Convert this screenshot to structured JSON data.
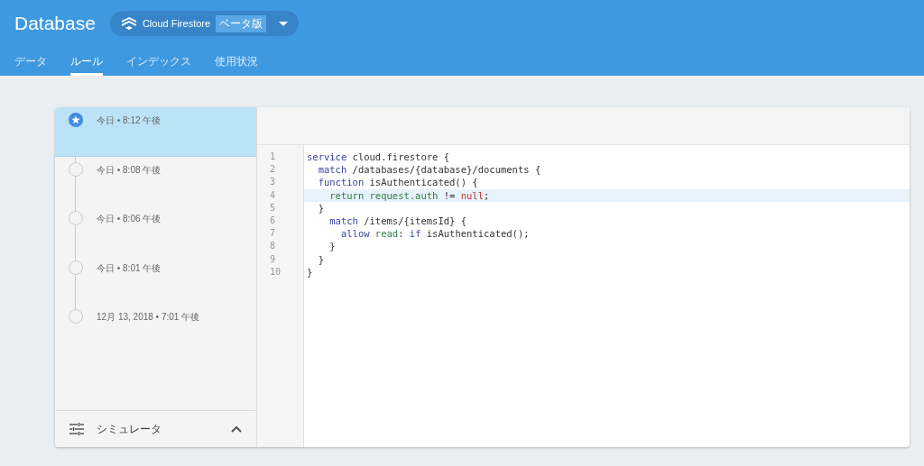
{
  "header": {
    "title": "Database",
    "product": {
      "name": "Cloud Firestore",
      "badge": "ベータ版"
    }
  },
  "tabs": [
    {
      "label": "データ",
      "selected": false
    },
    {
      "label": "ルール",
      "selected": true
    },
    {
      "label": "インデックス",
      "selected": false
    },
    {
      "label": "使用状況",
      "selected": false
    }
  ],
  "history": [
    {
      "label": "今日 • 8:12 午後",
      "selected": true
    },
    {
      "label": "今日 • 8:08 午後",
      "selected": false
    },
    {
      "label": "今日 • 8:06 午後",
      "selected": false
    },
    {
      "label": "今日 • 8:01 午後",
      "selected": false
    },
    {
      "label": "12月 13, 2018 • 7:01 午後",
      "selected": false
    }
  ],
  "simulator": {
    "label": "シミュレータ",
    "expanded": false
  },
  "code": [
    {
      "number": "1",
      "highlighted": false,
      "tokens": [
        {
          "kind": "keyword",
          "text": "service"
        },
        {
          "kind": "plain",
          "text": " cloud.firestore {"
        }
      ]
    },
    {
      "number": "2",
      "highlighted": false,
      "tokens": [
        {
          "kind": "keyword",
          "text": "  match"
        },
        {
          "kind": "plain",
          "text": " /databases/{database}/documents {"
        }
      ]
    },
    {
      "number": "3",
      "highlighted": false,
      "tokens": [
        {
          "kind": "keyword",
          "text": "  function"
        },
        {
          "kind": "plain",
          "text": " isAuthenticated() {"
        }
      ]
    },
    {
      "number": "4",
      "highlighted": true,
      "tokens": [
        {
          "kind": "name",
          "text": "    return request.auth"
        },
        {
          "kind": "plain",
          "text": " != "
        },
        {
          "kind": "literal",
          "text": "null"
        },
        {
          "kind": "plain",
          "text": ";"
        }
      ]
    },
    {
      "number": "5",
      "highlighted": false,
      "tokens": [
        {
          "kind": "plain",
          "text": "  }"
        }
      ]
    },
    {
      "number": "6",
      "highlighted": false,
      "tokens": [
        {
          "kind": "keyword",
          "text": "    match"
        },
        {
          "kind": "plain",
          "text": " /items/{itemsId} {"
        }
      ]
    },
    {
      "number": "7",
      "highlighted": false,
      "tokens": [
        {
          "kind": "keyword",
          "text": "      allow"
        },
        {
          "kind": "name",
          "text": " read"
        },
        {
          "kind": "plain",
          "text": ": "
        },
        {
          "kind": "keyword",
          "text": "if"
        },
        {
          "kind": "plain",
          "text": " isAuthenticated();"
        }
      ]
    },
    {
      "number": "8",
      "highlighted": false,
      "tokens": [
        {
          "kind": "plain",
          "text": "    }"
        }
      ]
    },
    {
      "number": "9",
      "highlighted": false,
      "tokens": [
        {
          "kind": "plain",
          "text": "  }"
        }
      ]
    },
    {
      "number": "10",
      "highlighted": false,
      "tokens": [
        {
          "kind": "plain",
          "text": "}"
        }
      ]
    }
  ]
}
